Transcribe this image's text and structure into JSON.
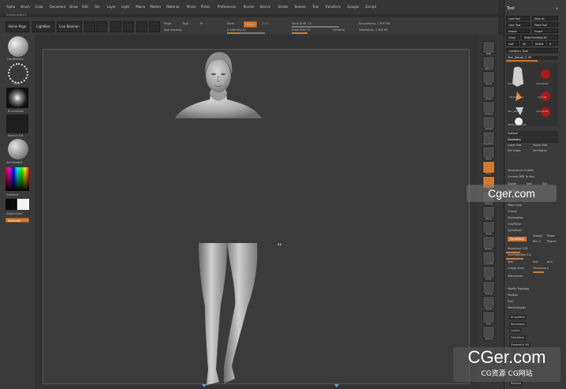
{
  "menu": [
    "Alpha",
    "Brush",
    "Color",
    "Document",
    "Draw",
    "Edit",
    "File",
    "Layer",
    "Light",
    "Macro",
    "Marker",
    "Material",
    "Movie",
    "Picker",
    "Preferences",
    "Render",
    "Stencil",
    "Stroke",
    "Texture",
    "Tool",
    "Transform",
    "Zplugin",
    "Zscript"
  ],
  "subtitle": "STANDS ROBOTS",
  "topbar": {
    "home": "Home Page",
    "lightbox": "LightBox",
    "live": "Live Boolean",
    "mrgb": "Mrgb",
    "rgb": "Rgb",
    "m": "M",
    "zadd": "Zadd",
    "zsub": "Zsub",
    "zcut": "Zcut",
    "rgb_intensity": "Rgb Intensity",
    "z_intensity": "Z Intensity 25",
    "focal_shift": "Focal Shift -74",
    "draw_size": "Draw Size 74",
    "dynamic": "Dynamic",
    "active_points": "ActivePoints: 7,900 Mil",
    "total_points": "TotalPoints: 7,900 Mil"
  },
  "left": {
    "brush": "ClayBuildup",
    "dots": "Dots",
    "alpha": "BrushAlpha",
    "texture": "Texture Off",
    "material": "SkinShade4",
    "gradient": "Gradient",
    "switch": "SwitchColor",
    "alternate": "Alternate"
  },
  "right_shelf": [
    "BPR",
    "SPix 3",
    "Scroll",
    "Zoom",
    "Actual",
    "AAHalf",
    "Dynamic",
    "Persp",
    "Floor",
    "Local",
    "Frame",
    "Move",
    "Scale",
    "Rotate",
    "Line Fill",
    "PolyF",
    "Transp",
    "Ghost",
    "Solo",
    "Xpose"
  ],
  "panel": {
    "title": "Tool",
    "buttons": [
      "Load Tool",
      "Save As",
      "Copy Tool",
      "Paste Tool",
      "Import",
      "Export",
      "Clone",
      "Make PolyMesh3D",
      "GoZ",
      "All",
      "Visible",
      "R",
      "Lightbox ▸ Tools"
    ],
    "current_tool": "Skin_Zbrush_2. 92",
    "thumbs": [
      "Skin_Zbrush_2",
      "Cylinder3D",
      "SimpleBrush",
      "Cylinder",
      "Skin_Zbrush_2",
      "Cylinder3D",
      "PM3D_Sphere3D"
    ],
    "subtool": "Subtool",
    "geometry": "Geometry",
    "geo_rows": [
      "Lower Res",
      "Higher Res",
      "Del Lower",
      "Del Higher",
      "Reconstruct Subdiv",
      "Convert BPR To Geo",
      "Divide",
      "Smt",
      "Suv",
      "ReUV",
      "Edge Loop",
      "Crease",
      "ShadowBox",
      "ClayPolish",
      "DynaMesh"
    ],
    "dyna_rows": [
      "DynaMesh",
      "Groups",
      "Polish",
      "Blur 2",
      "Project",
      "Resolution 128",
      "SubProjection 0.6",
      "Add",
      "Sub",
      "And",
      "Create Shell",
      "Thickness 4"
    ],
    "lower_rows": [
      "ZRemesher",
      "Modify Topology",
      "Position",
      "Size",
      "MeshIntegrity"
    ],
    "list_rows": [
      "ArrayMesh",
      "NanoMesh",
      "Layers",
      "FiberMesh",
      "Geometry HD",
      "Preview"
    ]
  },
  "watermarks": {
    "top": "Cger.com",
    "bottom": "CGer.com",
    "bottom_sub": "CG资源 CG网站"
  }
}
